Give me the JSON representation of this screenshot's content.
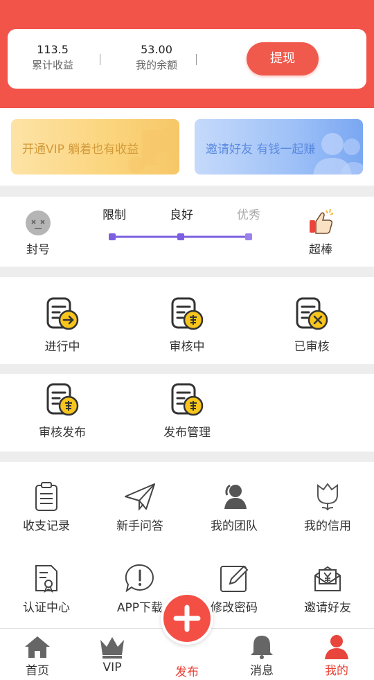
{
  "stats": {
    "total_income_value": "113.5",
    "total_income_label": "累计收益",
    "balance_value": "53.00",
    "balance_label": "我的余额",
    "withdraw_label": "提现"
  },
  "banners": {
    "vip_text": "开通VIP 躺着也有收益",
    "invite_text": "邀请好友 有钱一起赚"
  },
  "credit": {
    "banned_label": "封号",
    "excellent_label": "超棒",
    "levels": [
      "限制",
      "良好",
      "优秀"
    ],
    "current_level_index": 1
  },
  "task_status": {
    "items": [
      {
        "label": "进行中",
        "icon": "arrow-doc-icon"
      },
      {
        "label": "审核中",
        "icon": "review-doc-icon"
      },
      {
        "label": "已审核",
        "icon": "reject-doc-icon"
      }
    ]
  },
  "publish": {
    "items": [
      {
        "label": "审核发布",
        "icon": "review-doc-icon"
      },
      {
        "label": "发布管理",
        "icon": "review-doc-icon"
      }
    ]
  },
  "tools": {
    "items": [
      {
        "label": "收支记录",
        "icon": "clipboard-icon"
      },
      {
        "label": "新手问答",
        "icon": "paper-plane-icon"
      },
      {
        "label": "我的团队",
        "icon": "team-icon"
      },
      {
        "label": "我的信用",
        "icon": "tulip-icon"
      },
      {
        "label": "认证中心",
        "icon": "certificate-icon"
      },
      {
        "label": "APP下载",
        "icon": "info-bubble-icon"
      },
      {
        "label": "修改密码",
        "icon": "edit-icon"
      },
      {
        "label": "邀请好友",
        "icon": "yen-envelope-icon"
      }
    ]
  },
  "tabbar": {
    "items": [
      {
        "label": "首页",
        "icon": "home-icon"
      },
      {
        "label": "VIP",
        "icon": "crown-icon"
      },
      {
        "label": "发布",
        "icon": "plus-icon"
      },
      {
        "label": "消息",
        "icon": "bell-icon"
      },
      {
        "label": "我的",
        "icon": "user-icon"
      }
    ],
    "active_index": 4
  },
  "colors": {
    "brand_red": "#f2544a",
    "level_purple": "#7b5fe0",
    "coin_yellow": "#f7c51b"
  }
}
